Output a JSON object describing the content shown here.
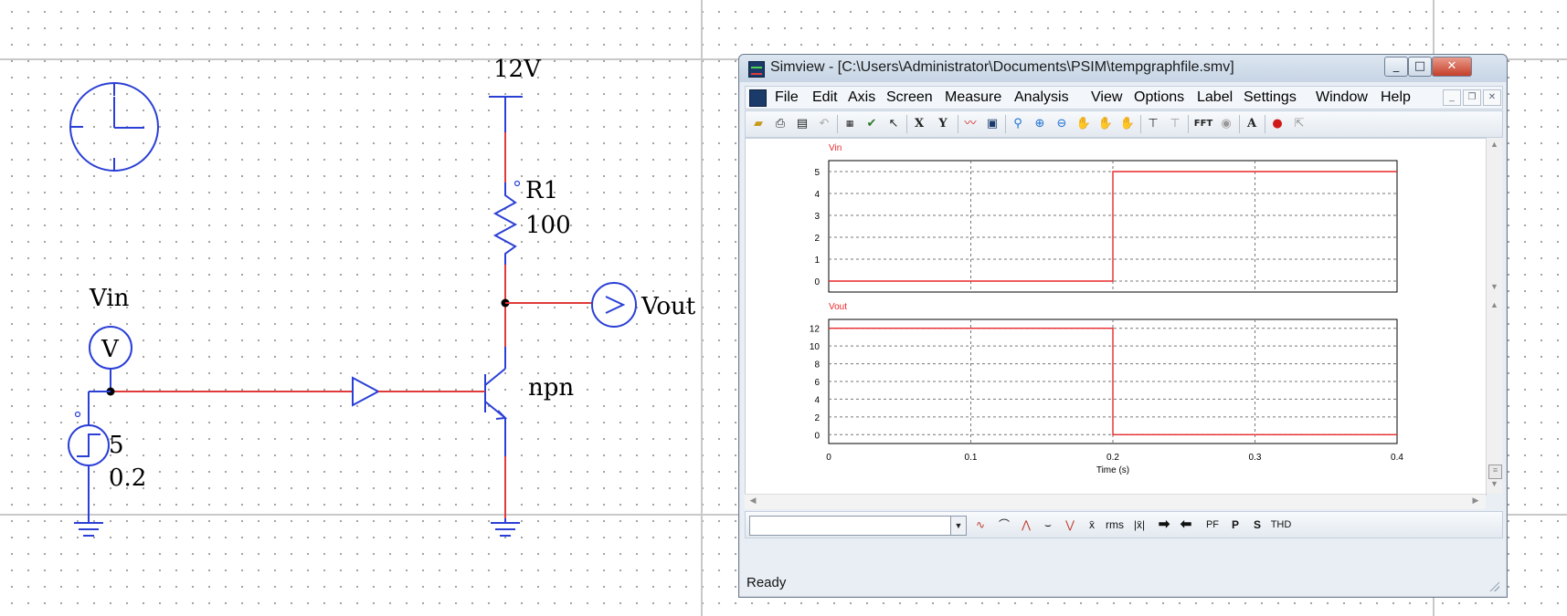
{
  "schematic": {
    "labels": {
      "supply": "12V",
      "resistor_name": "R1",
      "resistor_value": "100",
      "vin": "Vin",
      "voltmeter": "V",
      "vout": "Vout",
      "transistor": "npn",
      "source_amplitude": "5",
      "source_time": "0.2"
    },
    "colors": {
      "wire": "#e03a3a",
      "component": "#2a3fd6",
      "ground": "#2a3fd6"
    }
  },
  "simview": {
    "title": "Simview - [C:\\Users\\Administrator\\Documents\\PSIM\\tempgraphfile.smv]",
    "window_buttons": {
      "minimize": "_",
      "maximize": "□",
      "close": "✕"
    },
    "menu": [
      "File",
      "Edit",
      "Axis",
      "Screen",
      "Measure",
      "Analysis",
      "View",
      "Options",
      "Label",
      "Settings",
      "Window",
      "Help"
    ],
    "toolbar": {
      "x_label": "X",
      "y_label": "Y",
      "fft_label": "FFT",
      "text_label": "A"
    },
    "bottom_toolbar": {
      "combo_value": "",
      "avg_label": "x̄",
      "rms_label": "rms",
      "abs_label": "|x̄|",
      "pf_label": "PF",
      "p_label": "P",
      "s_label": "S",
      "thd_label": "THD"
    },
    "status": "Ready"
  },
  "chart_data": [
    {
      "type": "line",
      "title": "",
      "series": [
        {
          "name": "Vin",
          "color": "#e8282a",
          "x": [
            0,
            0.2,
            0.2,
            0.4
          ],
          "y": [
            0,
            0,
            5,
            5
          ]
        }
      ],
      "xlim": [
        0,
        0.4
      ],
      "ylim": [
        -0.5,
        5.5
      ],
      "yticks": [
        0,
        1,
        2,
        3,
        4,
        5
      ],
      "xticks": [
        0,
        0.1,
        0.2,
        0.3,
        0.4
      ],
      "xlabel": "",
      "ylabel": "",
      "grid": true
    },
    {
      "type": "line",
      "title": "",
      "series": [
        {
          "name": "Vout",
          "color": "#e8282a",
          "x": [
            0,
            0.2,
            0.2,
            0.4
          ],
          "y": [
            12,
            12,
            0,
            0
          ]
        }
      ],
      "xlim": [
        0,
        0.4
      ],
      "ylim": [
        -1,
        13
      ],
      "yticks": [
        0,
        2,
        4,
        6,
        8,
        10,
        12
      ],
      "xticks": [
        0,
        0.1,
        0.2,
        0.3,
        0.4
      ],
      "xtick_labels": [
        "0",
        "0.1",
        "0.2",
        "0.3",
        "0.4"
      ],
      "xlabel": "Time (s)",
      "ylabel": "",
      "grid": true
    }
  ]
}
